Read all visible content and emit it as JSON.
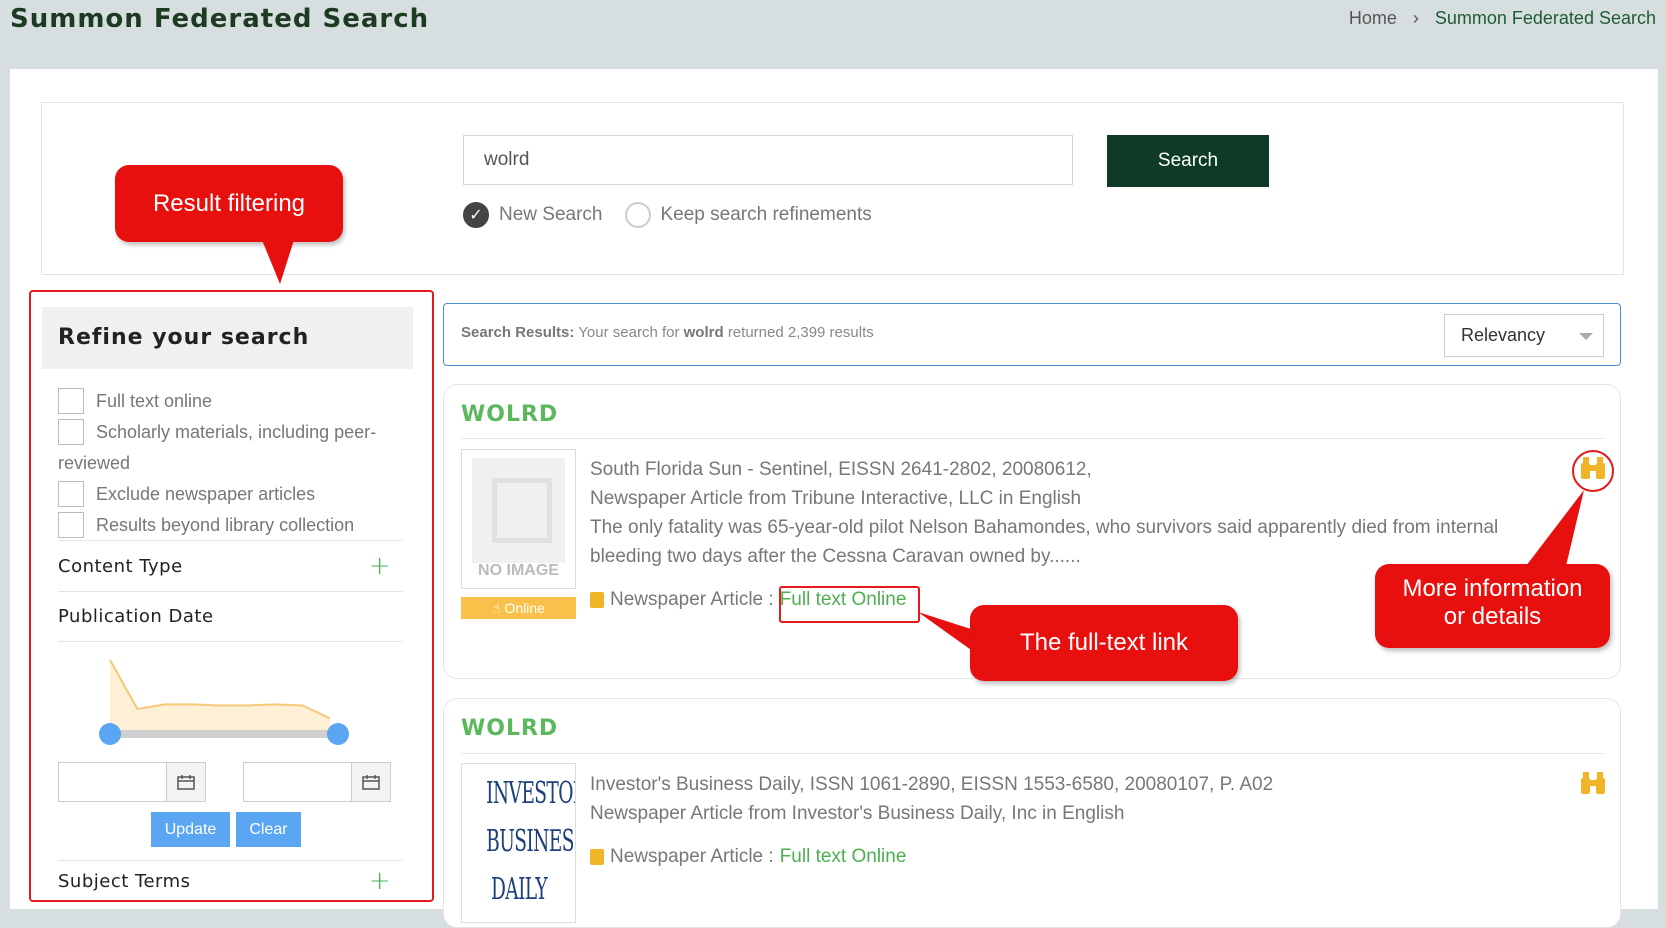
{
  "header": {
    "title": "Summon Federated Search",
    "breadcrumb_home": "Home",
    "breadcrumb_sep": "›",
    "breadcrumb_current": "Summon Federated Search"
  },
  "search": {
    "query": "wolrd",
    "button_label": "Search",
    "option_new": "New Search",
    "option_keep": "Keep search refinements"
  },
  "refine": {
    "heading": "Refine your search",
    "checkboxes": [
      "Full text online",
      "Scholarly materials, including peer-reviewed",
      "Exclude newspaper articles",
      "Results beyond library collection"
    ],
    "facets": {
      "content_type": "Content Type",
      "publication_date": "Publication Date",
      "subject_terms": "Subject Terms"
    },
    "update_label": "Update",
    "clear_label": "Clear"
  },
  "results": {
    "label": "Search Results:",
    "prefix": "Your search for",
    "term": "wolrd",
    "suffix": "returned 2,399 results",
    "sort": "Relevancy",
    "items": [
      {
        "title": "WOLRD",
        "thumb_text": "NO IMAGE",
        "badge": "Online",
        "source": "South Florida Sun - Sentinel, EISSN 2641-2802, 20080612,",
        "type_line": "Newspaper Article from Tribune Interactive, LLC in English",
        "snippet": "The only fatality was 65-year-old pilot Nelson Bahamondes, who survivors said apparently died from internal bleeding two days after the Cessna Caravan owned by......",
        "format": "Newspaper Article :",
        "link": "Full text Online"
      },
      {
        "title": "WOLRD",
        "thumb_text": "INVESTOR'S BUSINESS DAILY",
        "source": "Investor's Business Daily, ISSN 1061-2890, EISSN 1553-6580, 20080107, P. A02",
        "type_line": "Newspaper Article from Investor's Business Daily, Inc in English",
        "format": "Newspaper Article :",
        "link": "Full text Online"
      }
    ]
  },
  "callouts": {
    "filtering": "Result filtering",
    "fulltext": "The full-text link",
    "details_line1": "More information",
    "details_line2": "or details"
  },
  "icons": {
    "detail": "binoculars-icon",
    "calendar": "calendar-icon",
    "format": "newspaper-icon"
  },
  "colors": {
    "brand_dark": "#0d3b26",
    "title_green": "#5cb85c",
    "callout_red": "#e80f0f",
    "accent_blue": "#5aa6f2",
    "icon_gold": "#f0b429"
  },
  "chart_data": {
    "type": "area",
    "x": [
      0,
      1,
      2,
      3,
      4,
      5,
      6,
      7,
      8
    ],
    "values": [
      60,
      18,
      22,
      22,
      21,
      21,
      22,
      21,
      10
    ],
    "xlabel": "",
    "ylabel": ""
  }
}
